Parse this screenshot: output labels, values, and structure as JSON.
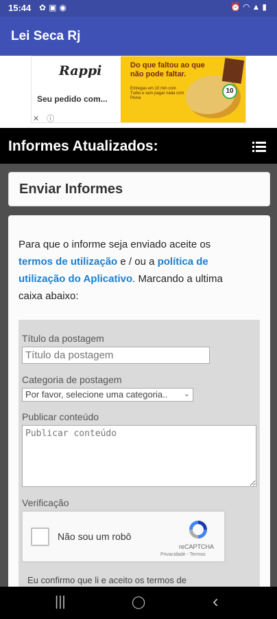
{
  "status_bar": {
    "time": "15:44",
    "left_icons": [
      "settings-icon",
      "image-icon",
      "sync-icon"
    ],
    "right_icons": [
      "alarm-icon",
      "wifi-icon",
      "signal-icon",
      "battery-icon"
    ]
  },
  "app_bar": {
    "title": "Lei Seca Rj",
    "color": "#3f51b5"
  },
  "ad": {
    "brand": "Rappi",
    "tagline": "Seu pedido com...",
    "headline": "Do que faltou ao que não pode faltar.",
    "subtext": "Entregas em 10 min com Turbo e sem pagar nada com Prime",
    "badge": "10",
    "close_icons": "✕ ⓘ"
  },
  "section_header": {
    "title": "Informes Atualizados:",
    "menu_icon": "list-menu-icon"
  },
  "card": {
    "title": "Enviar Informes"
  },
  "intro": {
    "before_terms": "Para que o informe seja enviado aceite os ",
    "terms_link": "termos de utilização",
    "middle": " e / ou a ",
    "policy_link": "política de utilização do Aplicativo",
    "after": ". Marcando a ultima caixa abaixo:"
  },
  "form": {
    "title_label": "Título da postagem",
    "title_placeholder": "Título da postagem",
    "category_label": "Categoria de postagem",
    "category_selected": "Por favor, selecione uma categoria..",
    "content_label": "Publicar conteúdo",
    "content_placeholder": "Publicar conteúdo",
    "verification_label": "Verificação"
  },
  "recaptcha": {
    "label": "Não sou um robô",
    "brand": "reCAPTCHA",
    "links": "Privacidade - Termos"
  },
  "confirm_text": "Eu confirmo que li e aceito os termos de",
  "nav_bar": {
    "recent": "|||",
    "home": "◯",
    "back": "‹"
  },
  "colors": {
    "link": "#1a7fd0",
    "status_bar": "#3b4aa3",
    "ad_yellow": "#f8c814"
  }
}
